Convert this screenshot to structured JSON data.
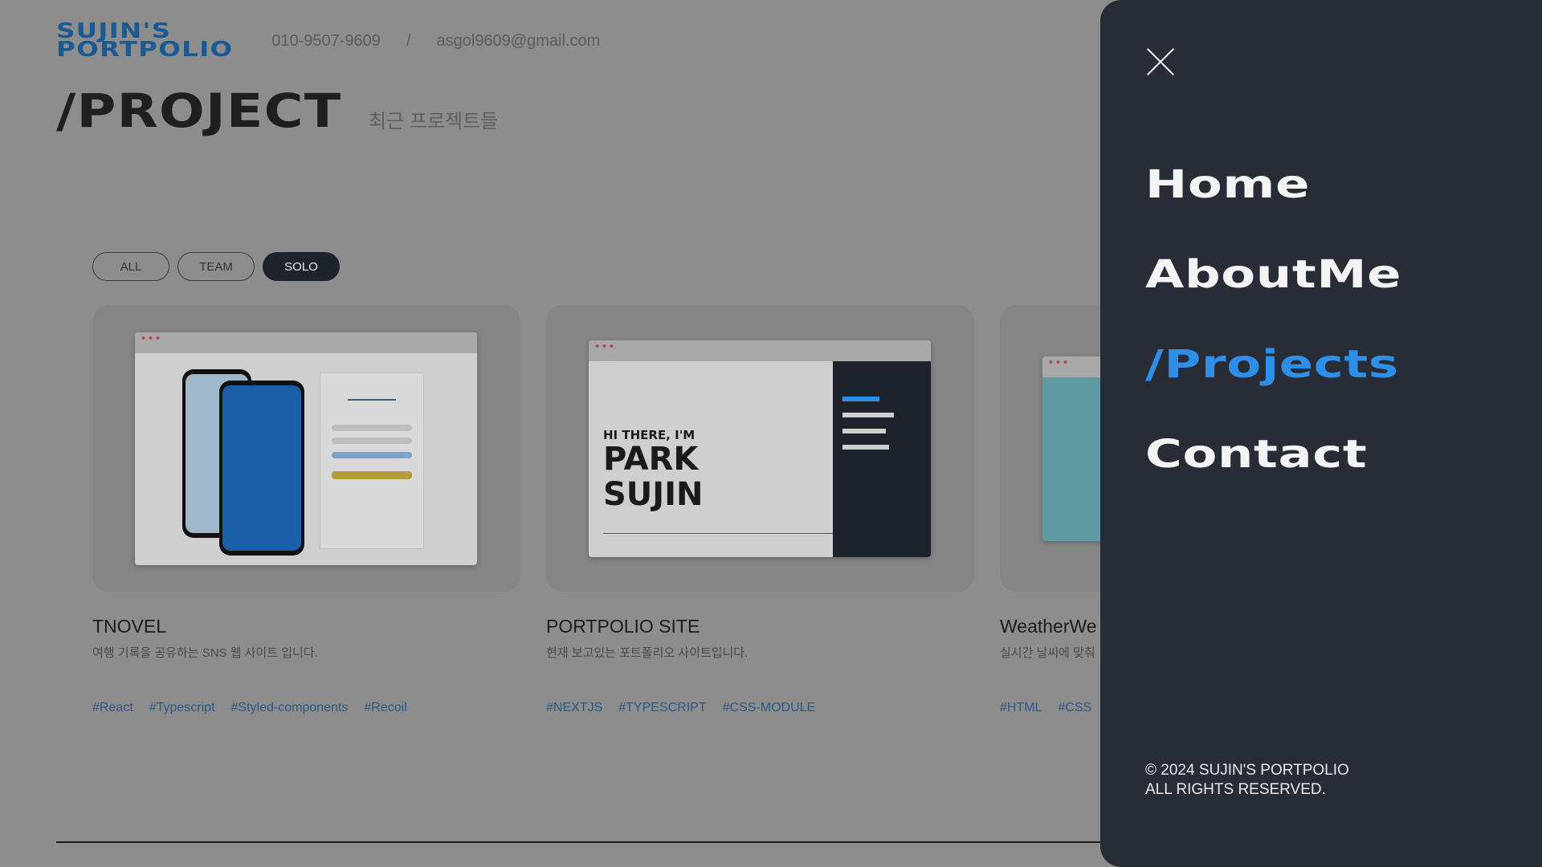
{
  "header": {
    "logo_line1": "SUJIN'S",
    "logo_line2": "PORTPOLIO",
    "phone": "010-9507-9609",
    "separator": "/",
    "email": "asgol9609@gmail.com"
  },
  "main": {
    "title": "/PROJECT",
    "subtitle": "최근 프로젝트들",
    "filters": [
      "ALL",
      "TEAM",
      "SOLO"
    ],
    "active_filter": "SOLO",
    "projects": [
      {
        "title": "TNOVEL",
        "description": "여행 기록을 공유하는 SNS 웹 사이트 입니다.",
        "tags": [
          "#React",
          "#Typescript",
          "#Styled-components",
          "#Recoil"
        ]
      },
      {
        "title": "PORTPOLIO SITE",
        "description": "현재 보고있는 포트폴리오 사이트입니다.",
        "tags": [
          "#NEXTJS",
          "#TYPESCRIPT",
          "#CSS-MODULE"
        ]
      },
      {
        "title": "WeatherWe",
        "description": "실시간 날씨에 맞춰",
        "tags": [
          "#HTML",
          "#CSS"
        ]
      }
    ]
  },
  "drawer": {
    "nav": [
      "Home",
      "AboutMe",
      "/Projects",
      "Contact"
    ],
    "active_nav": "/Projects",
    "footer_line1": "© 2024 SUJIN'S PORTPOLIO",
    "footer_line2": "ALL RIGHTS RESERVED."
  },
  "colors": {
    "accent": "#2f8fe6",
    "drawer_bg": "#282c36",
    "tag": "#2d5885"
  },
  "icons": {
    "close": "close-icon"
  }
}
